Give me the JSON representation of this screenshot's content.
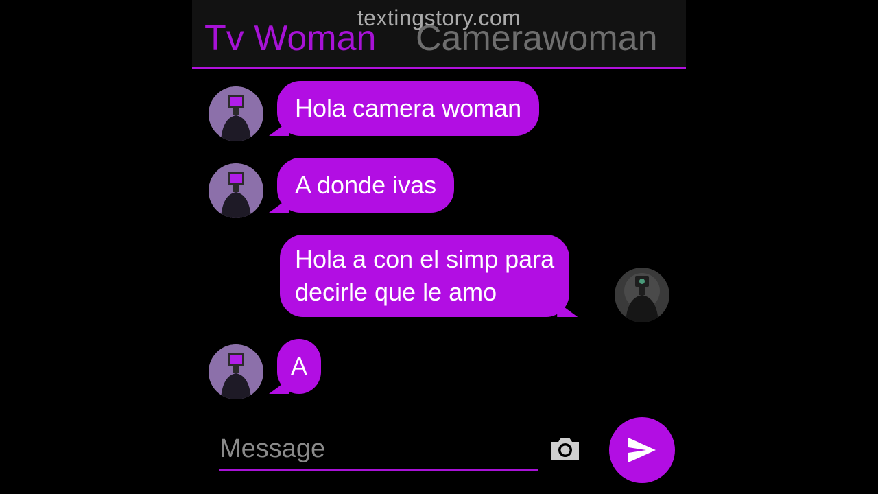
{
  "watermark": "textingstory.com",
  "header": {
    "tab_active": "Tv Woman",
    "tab_inactive": "Camerawoman"
  },
  "messages": [
    {
      "sender": "Tv Woman",
      "side": "left",
      "text": "Hola camera woman"
    },
    {
      "sender": "Tv Woman",
      "side": "left",
      "text": "A donde ivas"
    },
    {
      "sender": "Camerawoman",
      "side": "right",
      "lines": [
        "Hola a con el simp para",
        "decirle que le amo"
      ]
    },
    {
      "sender": "Tv Woman",
      "side": "left",
      "text": "A"
    }
  ],
  "composer": {
    "placeholder": "Message",
    "camera_icon": "camera-icon",
    "send_icon": "send-icon"
  },
  "colors": {
    "accent": "#b20ee3",
    "header_bg": "#121212",
    "active_tab": "#a712d6",
    "inactive_tab": "#6e6e6e"
  }
}
